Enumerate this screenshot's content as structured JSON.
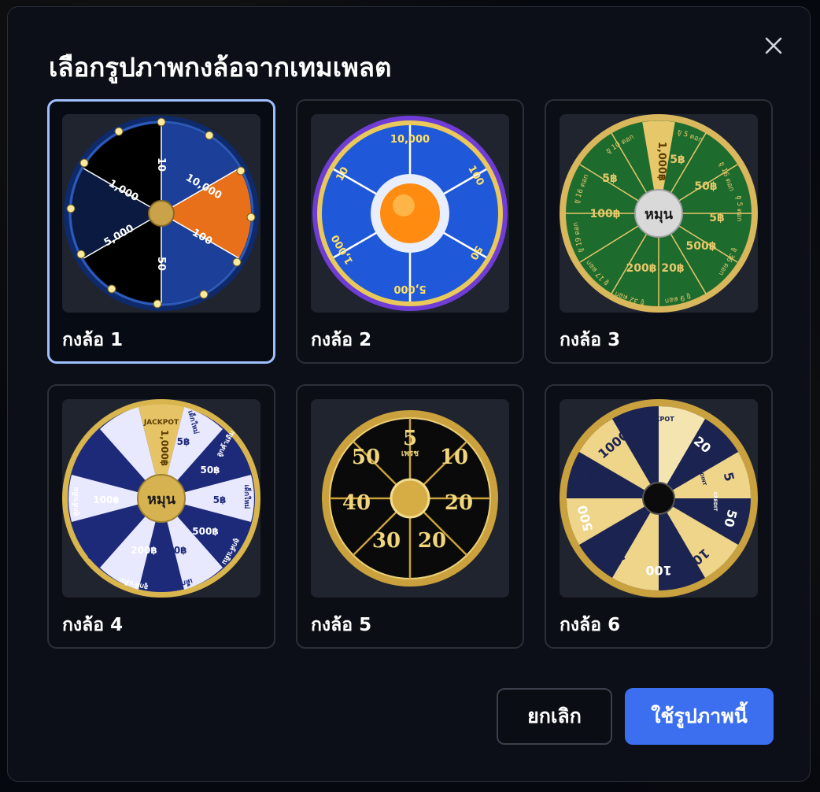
{
  "dialog": {
    "title": "เลือกรูปภาพกงล้อจากเทมเพลต",
    "close_icon": "close-icon"
  },
  "templates": [
    {
      "label": "กงล้อ 1",
      "selected": true,
      "texts": [
        "10",
        "10,000",
        "100",
        "50",
        "5,000",
        "1,000"
      ]
    },
    {
      "label": "กงล้อ 2",
      "selected": false,
      "texts": [
        "10,000",
        "100",
        "50",
        "5,000",
        "1,000",
        "10"
      ]
    },
    {
      "label": "กงล้อ 3",
      "selected": false,
      "texts": [
        "ยู 5 ดอก",
        "5฿",
        "50฿",
        "ยู 16 ดอก",
        "5฿",
        "ยู 5 ดอก",
        "500฿",
        "ยู 36 ดอก",
        "20฿",
        "ยู 9 ดอก",
        "200฿",
        "ยู 32 ดอก",
        "ยู 17 ดอก",
        "ยู 19 ดอก",
        "100฿",
        "ยู 16 ดอก",
        "5฿",
        "ยู 10 ดอก",
        "1,000฿",
        "หมุน"
      ]
    },
    {
      "label": "กงล้อ 4",
      "selected": false,
      "texts": [
        "JACKPOT",
        "1,000฿",
        "เด็กใหม่",
        "5฿",
        "ลูกค้าเดิม",
        "50฿",
        "เด็กใหม่",
        "5฿",
        "ลูกค้าเดิม",
        "500฿",
        "เด็กใหม่",
        "20฿",
        "ลูกค้าเดิม",
        "200฿",
        "เด็กใหม่",
        "10฿",
        "ลูกค้าเดิม",
        "100฿",
        "เด็กใหม่",
        "5฿",
        "หมุน"
      ]
    },
    {
      "label": "กงล้อ 5",
      "selected": false,
      "texts": [
        "5",
        "10",
        "20",
        "20",
        "30",
        "40",
        "50",
        "เพรช"
      ]
    },
    {
      "label": "กงล้อ 6",
      "selected": false,
      "texts": [
        "JACKPOT",
        "20",
        "5",
        "50",
        "10",
        "100",
        "20",
        "500",
        "JACKPOT",
        "1000",
        "CREDIT",
        "POINT"
      ]
    }
  ],
  "buttons": {
    "cancel": "ยกเลิก",
    "use": "ใช้รูปภาพนี้"
  },
  "colors": {
    "accent": "#3b6ff0",
    "selected_border": "#9ec0ff"
  }
}
